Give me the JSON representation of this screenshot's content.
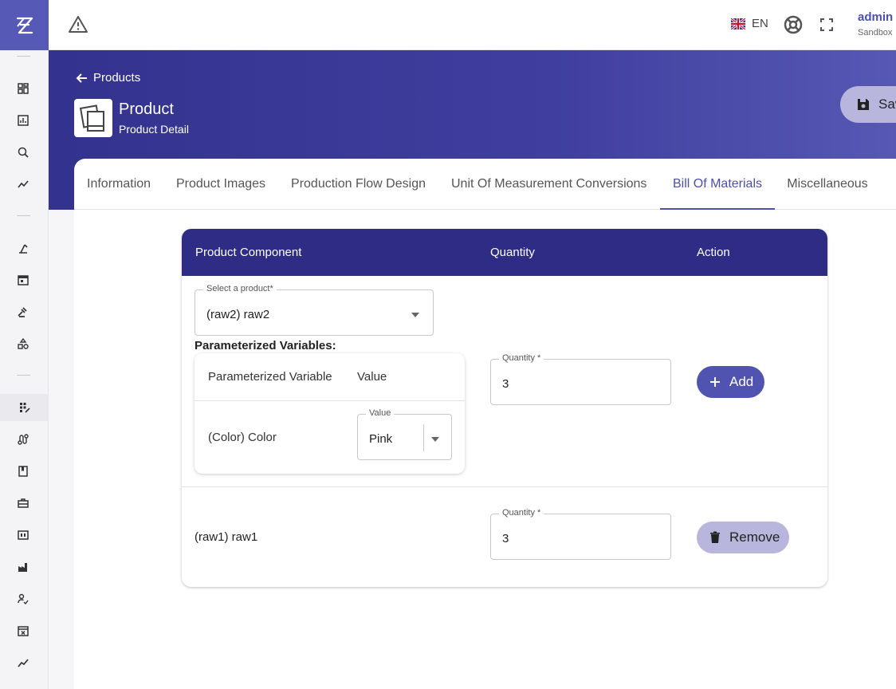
{
  "app": {
    "logo": "app-logo"
  },
  "topbar": {
    "lang_code": "EN",
    "user_name": "admin",
    "user_tenant": "Sandbox"
  },
  "header": {
    "back_label": "Products",
    "title": "Product",
    "subtitle": "Product Detail",
    "save_label": "Save"
  },
  "tabs": [
    {
      "label": "Information"
    },
    {
      "label": "Product Images"
    },
    {
      "label": "Production Flow Design"
    },
    {
      "label": "Unit Of Measurement Conversions"
    },
    {
      "label": "Bill Of Materials",
      "active": true
    },
    {
      "label": "Miscellaneous"
    }
  ],
  "table": {
    "columns": [
      "Product Component",
      "Quantity",
      "Action"
    ],
    "new_row": {
      "select_label": "Select a product*",
      "select_value": "(raw2) raw2",
      "pv_title": "Parameterized Variables:",
      "pv_columns": [
        "Parameterized Variable",
        "Value"
      ],
      "pv_rows": [
        {
          "variable": "(Color) Color",
          "value_label": "Value",
          "value": "Pink"
        }
      ],
      "quantity_label": "Quantity *",
      "quantity": "3",
      "action_label": "Add"
    },
    "rows": [
      {
        "component": "(raw1) raw1",
        "quantity_label": "Quantity *",
        "quantity": "3",
        "action_label": "Remove"
      }
    ]
  },
  "colors": {
    "primary": "#4c4fb0",
    "header_band": "#3a3996",
    "table_header": "#2e2c85",
    "remove_button": "#b9b6dd"
  }
}
